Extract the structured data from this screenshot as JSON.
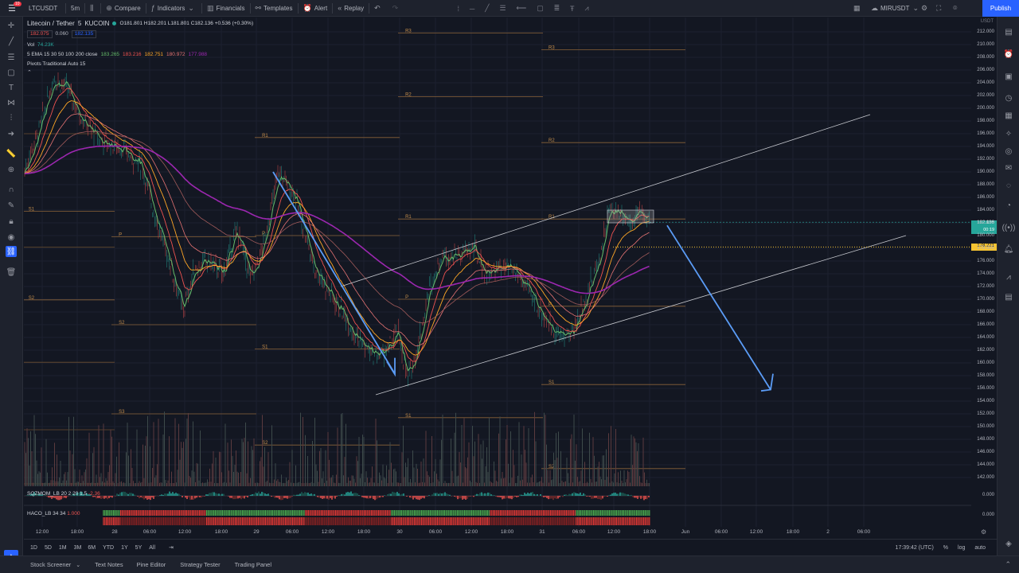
{
  "topbar": {
    "symbol": "LTCUSDT",
    "interval": "5m",
    "compare": "Compare",
    "indicators": "Indicators",
    "financials": "Financials",
    "templates": "Templates",
    "alert": "Alert",
    "replay": "Replay",
    "layout_name": "MIRUSDT",
    "publish": "Publish",
    "notif_count": "10"
  },
  "legend": {
    "title": "Litecoin / Tether",
    "interval": "5",
    "exchange": "KUCOIN",
    "ohlc": "O181.801 H182.201 L181.801 C182.136 +0.536 (+0.30%)",
    "bid": "182.075",
    "spread": "0.060",
    "ask": "182.135",
    "vol_label": "Vol",
    "vol_value": "74.23K",
    "ema_label": "5 EMA 15 30 50 100 200 close",
    "ema_values": [
      "183.265",
      "183.216",
      "182.751",
      "180.972",
      "177.988"
    ],
    "pivots_label": "Pivots Traditional Auto 15"
  },
  "price_axis": {
    "currency": "USDT",
    "ticks": [
      "212.000",
      "210.000",
      "208.000",
      "206.000",
      "204.000",
      "202.000",
      "200.000",
      "198.000",
      "196.000",
      "194.000",
      "192.000",
      "190.000",
      "188.000",
      "186.000",
      "184.000",
      "182.000",
      "180.000",
      "178.000",
      "176.000",
      "174.000",
      "172.000",
      "170.000",
      "168.000",
      "166.000",
      "164.000",
      "162.000",
      "160.000",
      "158.000",
      "156.000",
      "154.000",
      "152.000",
      "150.000",
      "148.000",
      "146.000",
      "144.000",
      "142.000"
    ],
    "last_price": "182.136",
    "countdown": "00:19",
    "line_price": "178.221",
    "sqzmom_value": "0.000",
    "haco_value": "0.000"
  },
  "time_axis": {
    "labels": [
      "12:00",
      "18:00",
      "28",
      "06:00",
      "12:00",
      "18:00",
      "29",
      "06:00",
      "12:00",
      "18:00",
      "30",
      "06:00",
      "12:00",
      "18:00",
      "31",
      "06:00",
      "12:00",
      "18:00",
      "Jun",
      "06:00",
      "12:00",
      "18:00",
      "2",
      "06:00"
    ]
  },
  "pivot_labels": [
    "R3",
    "R3",
    "R2",
    "R2",
    "R1",
    "R1",
    "R1",
    "P",
    "P",
    "P",
    "P",
    "S1",
    "S1",
    "S1",
    "S1",
    "S2",
    "S2",
    "S2",
    "S2",
    "S3"
  ],
  "indicators": {
    "sqzmom": "SQZMOM_LB 20 2 20 1.5",
    "sqzmom_val": "-2.36",
    "haco": "HACO_LB 34 34",
    "haco_val": "1.000"
  },
  "bottombar": {
    "ranges": [
      "1D",
      "5D",
      "1M",
      "3M",
      "6M",
      "YTD",
      "1Y",
      "5Y",
      "All"
    ],
    "clock": "17:39:42 (UTC)",
    "pct": "%",
    "log": "log",
    "auto": "auto"
  },
  "footer": {
    "tabs": [
      "Stock Screener",
      "Text Notes",
      "Pine Editor",
      "Strategy Tester",
      "Trading Panel"
    ]
  },
  "colors": {
    "bg": "#131722",
    "panel": "#1e222d",
    "accent": "#2962ff",
    "pivot": "#c38d4b",
    "ema_slow": "#9c27b0",
    "arrow": "#5b9cf6"
  }
}
